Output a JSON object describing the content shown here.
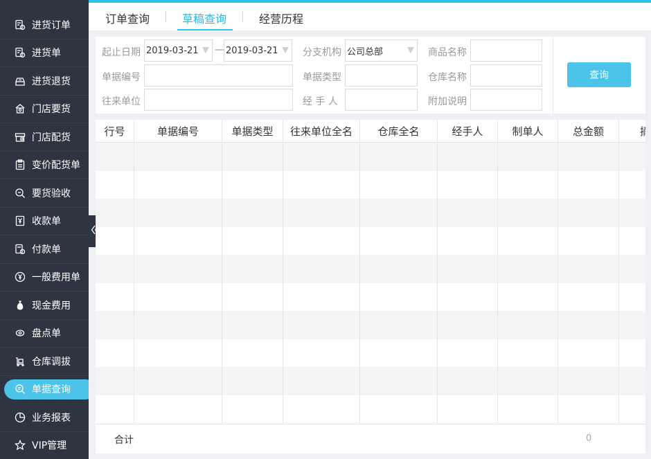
{
  "sidebar": {
    "items": [
      {
        "label": "进货订单",
        "icon": "purchase-order-icon"
      },
      {
        "label": "进货单",
        "icon": "purchase-slip-icon"
      },
      {
        "label": "进货退货",
        "icon": "purchase-return-icon"
      },
      {
        "label": "门店要货",
        "icon": "store-request-icon"
      },
      {
        "label": "门店配货",
        "icon": "store-distribution-icon"
      },
      {
        "label": "变价配货单",
        "icon": "price-change-icon"
      },
      {
        "label": "要货验收",
        "icon": "request-inspection-icon"
      },
      {
        "label": "收款单",
        "icon": "receipt-icon"
      },
      {
        "label": "付款单",
        "icon": "payment-icon"
      },
      {
        "label": "一般费用单",
        "icon": "yen-circle-icon"
      },
      {
        "label": "现金费用",
        "icon": "money-bag-icon"
      },
      {
        "label": "盘点单",
        "icon": "inventory-icon"
      },
      {
        "label": "仓库调拔",
        "icon": "warehouse-transfer-icon"
      },
      {
        "label": "单据查询",
        "icon": "document-search-icon",
        "active": true
      },
      {
        "label": "业务报表",
        "icon": "pie-chart-icon"
      },
      {
        "label": "VIP管理",
        "icon": "star-icon"
      }
    ]
  },
  "tabs": [
    {
      "label": "订单查询",
      "active": false
    },
    {
      "label": "草稿查询",
      "active": true
    },
    {
      "label": "经营历程",
      "active": false
    }
  ],
  "filter": {
    "date_label": "起止日期",
    "date_from": "2019-03-21",
    "date_sep": "—",
    "date_to": "2019-03-21",
    "branch_label": "分支机构",
    "branch_value": "公司总部",
    "product_label": "商品名称",
    "product_value": "",
    "doc_no_label": "单据编号",
    "doc_no_value": "",
    "doc_type_label": "单据类型",
    "doc_type_value": "",
    "warehouse_label": "仓库名称",
    "warehouse_value": "",
    "partner_label": "往来单位",
    "partner_value": "",
    "handler_label": "经 手 人",
    "handler_value": "",
    "note_label": "附加说明",
    "note_value": "",
    "query_button": "查询"
  },
  "table": {
    "columns": [
      "行号",
      "单据编号",
      "单据类型",
      "往来单位全名",
      "仓库全名",
      "经手人",
      "制单人",
      "总金额",
      "摘"
    ],
    "rows": [],
    "footer_label": "合计",
    "footer_total": "0"
  },
  "colors": {
    "accent": "#28c4ea",
    "sidebar_bg": "#2f3540",
    "active_item": "#4cc3e8"
  }
}
